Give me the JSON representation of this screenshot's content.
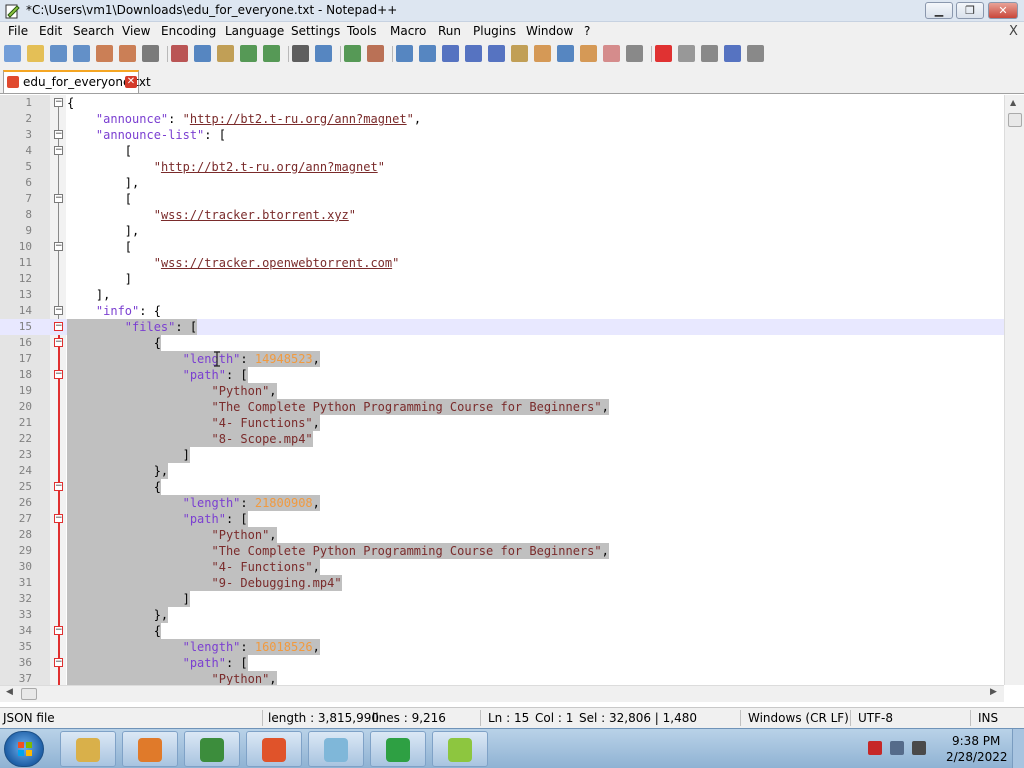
{
  "window": {
    "title": "*C:\\Users\\vm1\\Downloads\\edu_for_everyone.txt - Notepad++",
    "minimize_label": "▁",
    "maximize_label": "❐",
    "close_label": "✕"
  },
  "menu": {
    "items": [
      "File",
      "Edit",
      "Search",
      "View",
      "Encoding",
      "Language",
      "Settings",
      "Tools",
      "Macro",
      "Run",
      "Plugins",
      "Window",
      "?"
    ],
    "close_doc": "X"
  },
  "toolbar": {
    "icons": [
      "new-file-icon",
      "open-file-icon",
      "save-icon",
      "save-all-icon",
      "close-icon",
      "close-all-icon",
      "print-icon",
      "cut-icon",
      "copy-icon",
      "paste-icon",
      "undo-icon",
      "redo-icon",
      "find-icon",
      "replace-icon",
      "zoom-in-icon",
      "zoom-out-icon",
      "sync-vertical-icon",
      "sync-horizontal-icon",
      "word-wrap-icon",
      "show-all-chars-icon",
      "indent-guide-icon",
      "udl-icon",
      "doc-map-icon",
      "function-list-icon",
      "folder-workspace-icon",
      "doc-list-icon",
      "monitoring-icon",
      "record-macro-icon",
      "stop-record-icon",
      "play-macro-icon",
      "run-macro-multiple-icon",
      "save-macro-icon"
    ]
  },
  "tab": {
    "label": "edu_for_everyone.txt",
    "close_icon": "✕"
  },
  "editor": {
    "lines": [
      {
        "n": "1",
        "text": "{"
      },
      {
        "n": "2",
        "text": "    \"announce\": \"http://bt2.t-ru.org/ann?magnet\","
      },
      {
        "n": "3",
        "text": "    \"announce-list\": ["
      },
      {
        "n": "4",
        "text": "        ["
      },
      {
        "n": "5",
        "text": "            \"http://bt2.t-ru.org/ann?magnet\""
      },
      {
        "n": "6",
        "text": "        ],"
      },
      {
        "n": "7",
        "text": "        ["
      },
      {
        "n": "8",
        "text": "            \"wss://tracker.btorrent.xyz\""
      },
      {
        "n": "9",
        "text": "        ],"
      },
      {
        "n": "10",
        "text": "        ["
      },
      {
        "n": "11",
        "text": "            \"wss://tracker.openwebtorrent.com\""
      },
      {
        "n": "12",
        "text": "        ]"
      },
      {
        "n": "13",
        "text": "    ],"
      },
      {
        "n": "14",
        "text": "    \"info\": {"
      },
      {
        "n": "15",
        "text": "        \"files\": ["
      },
      {
        "n": "16",
        "text": "            {"
      },
      {
        "n": "17",
        "text": "                \"length\": 14948523,"
      },
      {
        "n": "18",
        "text": "                \"path\": ["
      },
      {
        "n": "19",
        "text": "                    \"Python\","
      },
      {
        "n": "20",
        "text": "                    \"The Complete Python Programming Course for Beginners\","
      },
      {
        "n": "21",
        "text": "                    \"4- Functions\","
      },
      {
        "n": "22",
        "text": "                    \"8- Scope.mp4\""
      },
      {
        "n": "23",
        "text": "                ]"
      },
      {
        "n": "24",
        "text": "            },"
      },
      {
        "n": "25",
        "text": "            {"
      },
      {
        "n": "26",
        "text": "                \"length\": 21800908,"
      },
      {
        "n": "27",
        "text": "                \"path\": ["
      },
      {
        "n": "28",
        "text": "                    \"Python\","
      },
      {
        "n": "29",
        "text": "                    \"The Complete Python Programming Course for Beginners\","
      },
      {
        "n": "30",
        "text": "                    \"4- Functions\","
      },
      {
        "n": "31",
        "text": "                    \"9- Debugging.mp4\""
      },
      {
        "n": "32",
        "text": "                ]"
      },
      {
        "n": "33",
        "text": "            },"
      },
      {
        "n": "34",
        "text": "            {"
      },
      {
        "n": "35",
        "text": "                \"length\": 16018526,"
      },
      {
        "n": "36",
        "text": "                \"path\": ["
      },
      {
        "n": "37",
        "text": "                    \"Python\","
      }
    ],
    "fold_lines": [
      "1",
      "3",
      "4",
      "7",
      "10",
      "14",
      "15",
      "16",
      "18",
      "25",
      "27",
      "34",
      "36"
    ],
    "selection_start_line": "15",
    "current_line": "15"
  },
  "status": {
    "file_type": "JSON file",
    "length": "length : 3,815,990",
    "lines": "lines : 9,216",
    "ln": "Ln : 15",
    "col": "Col : 1",
    "sel": "Sel : 32,806 | 1,480",
    "eol": "Windows (CR LF)",
    "encoding": "UTF-8",
    "mode": "INS"
  },
  "taskbar": {
    "apps": [
      {
        "name": "explorer-app",
        "color": "#d9b04a"
      },
      {
        "name": "media-player-app",
        "color": "#e07a2a"
      },
      {
        "name": "chrome-app",
        "color": "#3c8d3c"
      },
      {
        "name": "firefox-app",
        "color": "#e0532a"
      },
      {
        "name": "notepad-app",
        "color": "#7fb7d9"
      },
      {
        "name": "fe-app",
        "color": "#2ea043"
      },
      {
        "name": "notepadpp-app",
        "color": "#8dc63f"
      }
    ],
    "time": "9:38 PM",
    "date": "2/28/2022"
  },
  "colors": {
    "key": "#7b3fd1",
    "string": "#7a2b2b",
    "number": "#f19a3f",
    "selection": "#c0c0c0"
  }
}
